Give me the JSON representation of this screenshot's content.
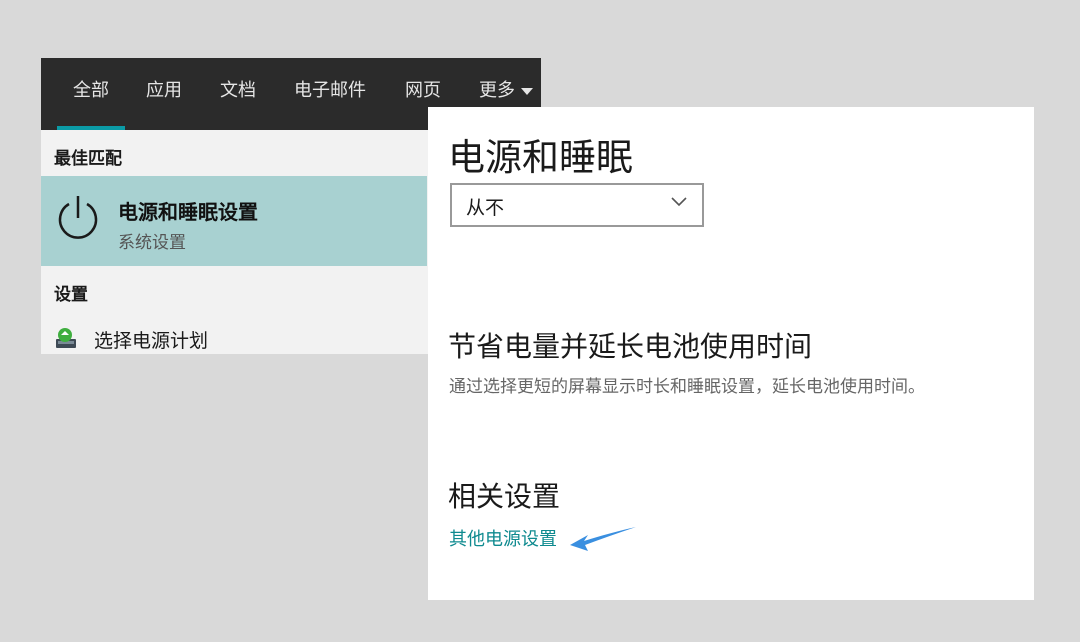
{
  "search": {
    "tabs": [
      {
        "label": "全部",
        "active": true
      },
      {
        "label": "应用"
      },
      {
        "label": "文档"
      },
      {
        "label": "电子邮件"
      },
      {
        "label": "网页"
      },
      {
        "label": "更多"
      }
    ],
    "best_match_label": "最佳匹配",
    "best_match": {
      "title": "电源和睡眠设置",
      "subtitle": "系统设置",
      "icon": "power-icon"
    },
    "settings_label": "设置",
    "settings_items": [
      {
        "label": "选择电源计划",
        "icon": "power-plan-icon"
      }
    ]
  },
  "settings": {
    "title": "电源和睡眠",
    "dropdown_value": "从不",
    "battery_heading": "节省电量并延长电池使用时间",
    "battery_desc": "通过选择更短的屏幕显示时长和睡眠设置，延长电池使用时间。",
    "related_heading": "相关设置",
    "related_link": "其他电源设置"
  },
  "colors": {
    "tab_bar": "#2b2b2b",
    "tab_accent": "#0b9ba6",
    "best_match_bg": "#a8d1d1",
    "link": "#0e8a8f",
    "arrow": "#3a8fe0"
  }
}
